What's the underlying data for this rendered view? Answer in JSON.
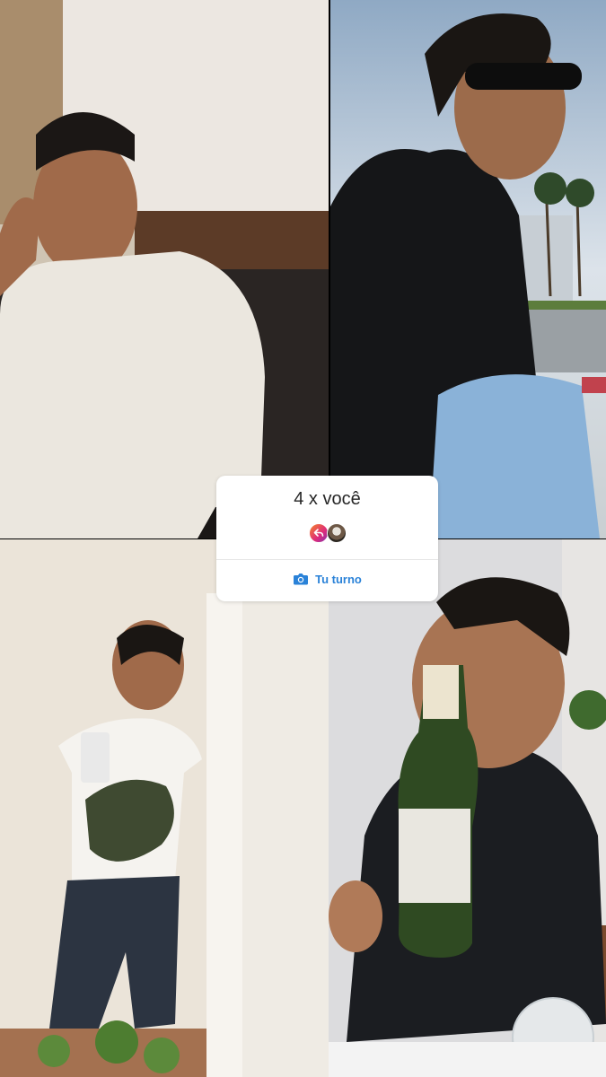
{
  "card": {
    "title": "4 x você",
    "reply_icon": "reply-arrow-icon",
    "button_icon": "camera-icon",
    "button_label": "Tu turno",
    "accent_color": "#2a82d8"
  },
  "photos": [
    {
      "name": "white-turtleneck-portrait"
    },
    {
      "name": "sunglasses-seaside-portrait"
    },
    {
      "name": "mirror-selfie"
    },
    {
      "name": "wine-bottle-selfie"
    }
  ]
}
